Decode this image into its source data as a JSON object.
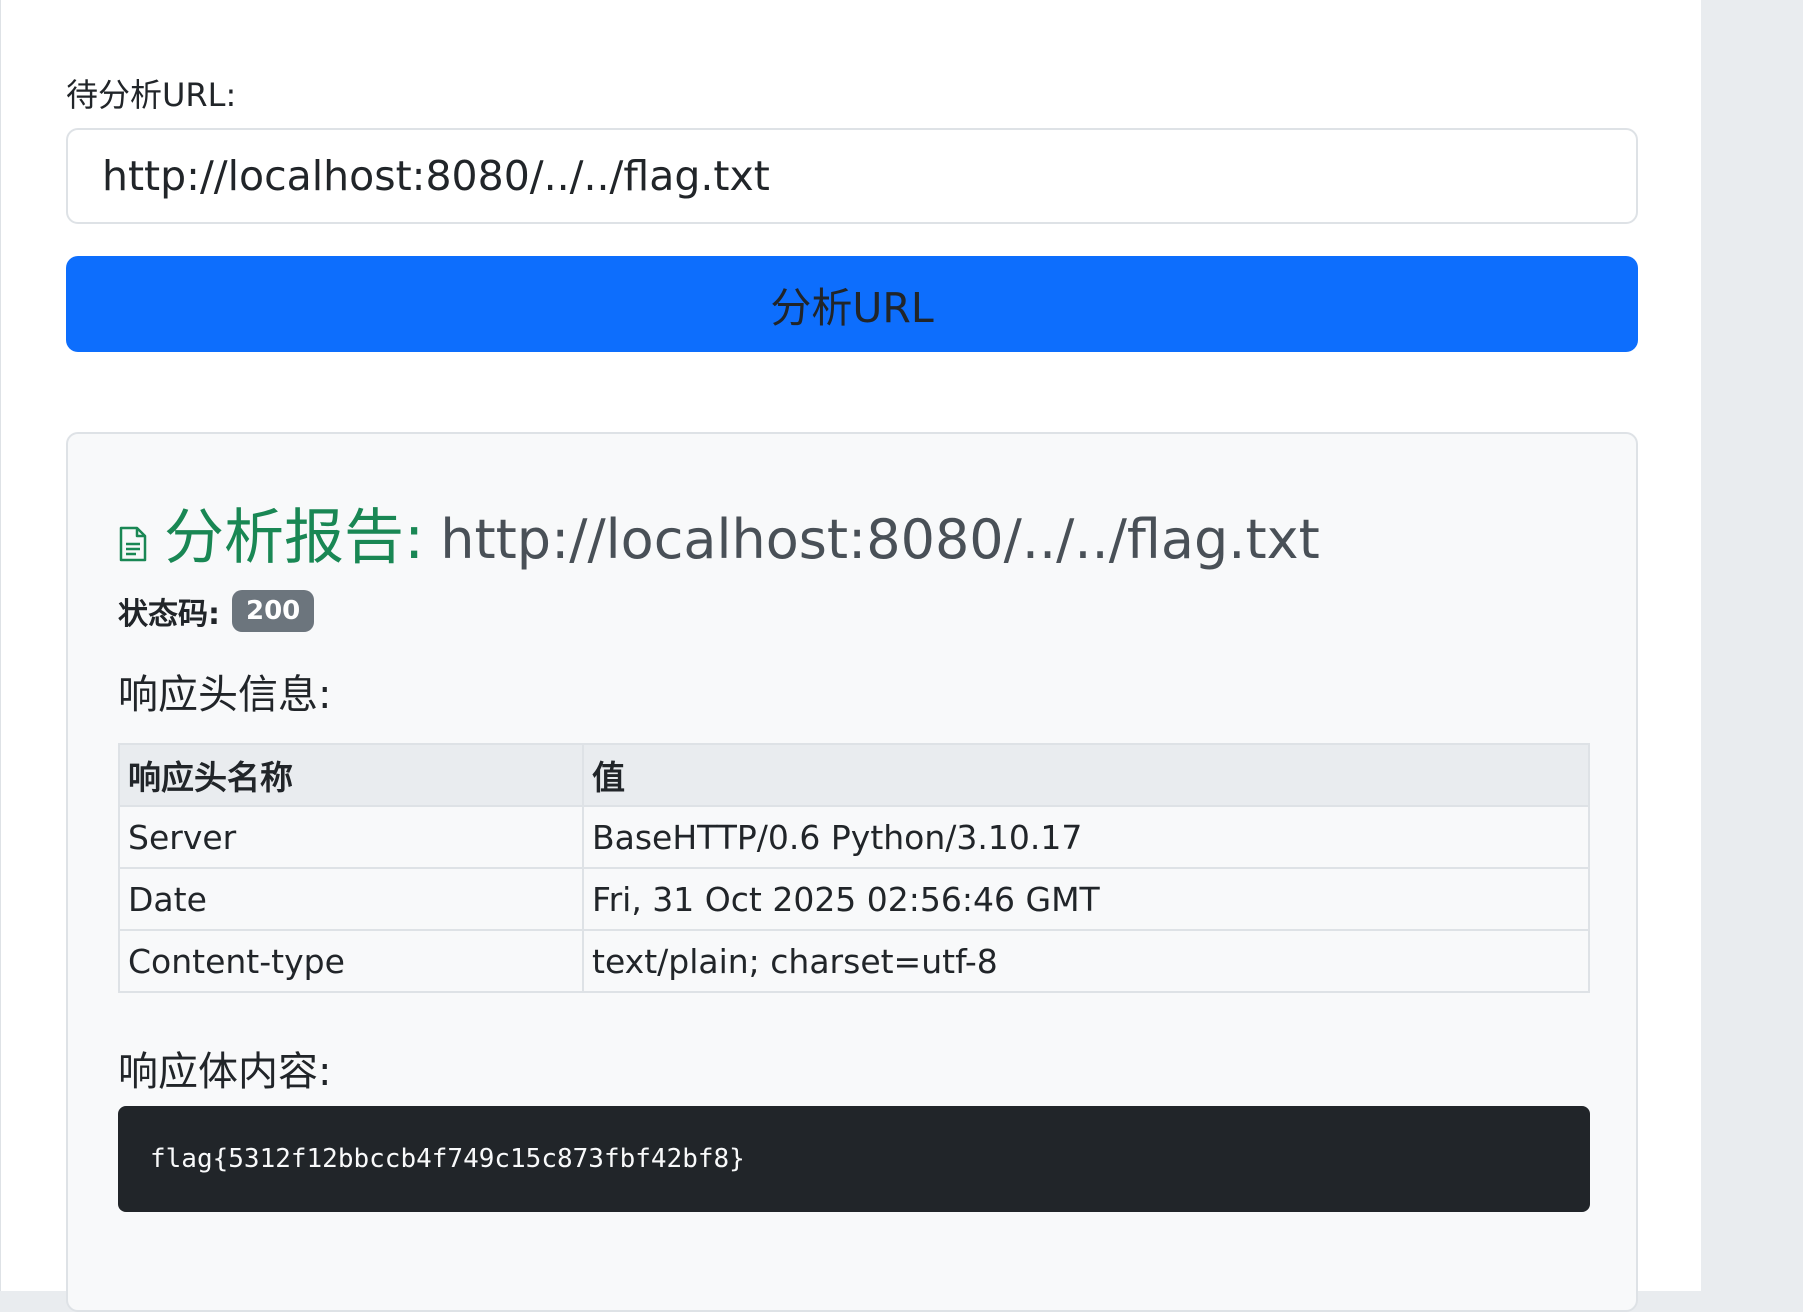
{
  "form": {
    "url_label": "待分析URL:",
    "url_value": "http://localhost:8080/../../flag.txt",
    "analyze_button": "分析URL"
  },
  "report": {
    "title_prefix": "分析报告:",
    "title_url": "http://localhost:8080/../../flag.txt",
    "icon": "document-icon",
    "status_label": "状态码:",
    "status_code": "200",
    "headers_heading": "响应头信息:",
    "headers_table": {
      "columns": [
        "响应头名称",
        "值"
      ],
      "rows": [
        {
          "name": "Server",
          "value": "BaseHTTP/0.6 Python/3.10.17"
        },
        {
          "name": "Date",
          "value": "Fri, 31 Oct 2025 02:56:46 GMT"
        },
        {
          "name": "Content-type",
          "value": "text/plain; charset=utf-8"
        }
      ]
    },
    "body_heading": "响应体内容:",
    "body_content": "flag{5312f12bbccb4f749c15c873fbf42bf8}"
  },
  "colors": {
    "primary": "#0d6efd",
    "success": "#198754",
    "badge": "#6c757d",
    "code_bg": "#212529"
  }
}
